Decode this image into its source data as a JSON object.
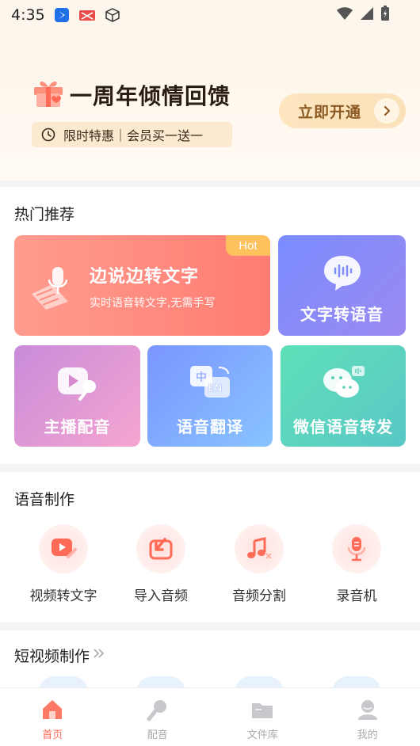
{
  "status_bar": {
    "time": "4:35"
  },
  "banner": {
    "title": "一周年倾情回馈",
    "promo": "限时特惠｜会员买一送一",
    "cta_label": "立即开通"
  },
  "hot": {
    "title": "热门推荐",
    "big_card": {
      "badge": "Hot",
      "title": "边说边转文字",
      "subtitle": "实时语音转文字,无需手写"
    },
    "cards": [
      {
        "label": "文字转语音"
      },
      {
        "label": "主播配音"
      },
      {
        "label": "语音翻译"
      },
      {
        "label": "微信语音转发"
      }
    ]
  },
  "voice": {
    "title": "语音制作",
    "tools": [
      {
        "label": "视频转文字",
        "icon": "video-to-text-icon"
      },
      {
        "label": "导入音频",
        "icon": "import-audio-icon"
      },
      {
        "label": "音频分割",
        "icon": "audio-split-icon"
      },
      {
        "label": "录音机",
        "icon": "recorder-icon"
      }
    ]
  },
  "video": {
    "title": "短视频制作"
  },
  "nav": {
    "items": [
      {
        "label": "首页"
      },
      {
        "label": "配音"
      },
      {
        "label": "文件库"
      },
      {
        "label": "我的"
      }
    ]
  },
  "colors": {
    "accent": "#ff6b57",
    "cta_text": "#8b5a22"
  }
}
